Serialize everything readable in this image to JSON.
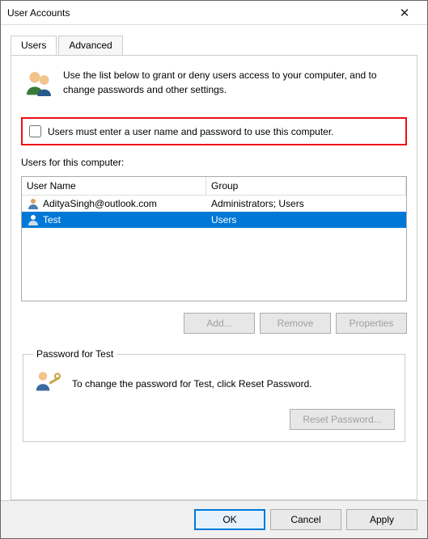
{
  "title": "User Accounts",
  "tabs": {
    "users": "Users",
    "advanced": "Advanced"
  },
  "intro": "Use the list below to grant or deny users access to your computer, and to change passwords and other settings.",
  "checkbox_label": "Users must enter a user name and password to use this computer.",
  "checkbox_checked": false,
  "users_section_label": "Users for this computer:",
  "columns": {
    "name": "User Name",
    "group": "Group"
  },
  "users": [
    {
      "name": "AdityaSingh@outlook.com",
      "group": "Administrators; Users",
      "selected": false
    },
    {
      "name": "Test",
      "group": "Users",
      "selected": true
    }
  ],
  "buttons": {
    "add": "Add...",
    "remove": "Remove",
    "properties": "Properties"
  },
  "password_group_label": "Password for Test",
  "password_text": "To change the password for Test, click Reset Password.",
  "reset_password": "Reset Password...",
  "footer": {
    "ok": "OK",
    "cancel": "Cancel",
    "apply": "Apply"
  }
}
